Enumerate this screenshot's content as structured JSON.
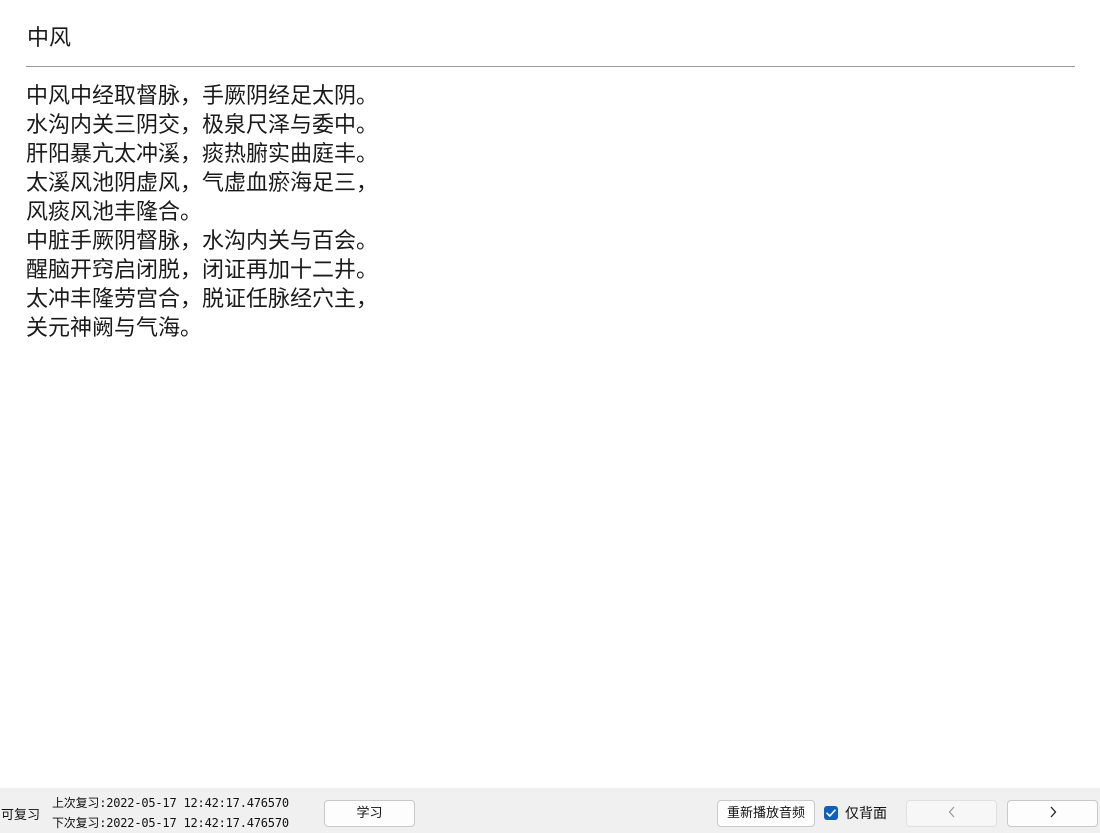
{
  "card": {
    "title": "中风",
    "lines": [
      "中风中经取督脉，手厥阴经足太阴。",
      "水沟内关三阴交，极泉尺泽与委中。",
      "肝阳暴亢太冲溪，痰热腑实曲庭丰。",
      "太溪风池阴虚风，气虚血瘀海足三，",
      "风痰风池丰隆合。",
      "中脏手厥阴督脉，水沟内关与百会。",
      "醒脑开窍启闭脱，闭证再加十二井。",
      "太冲丰隆劳宫合，脱证任脉经穴主，",
      "关元神阙与气海。"
    ]
  },
  "bottombar": {
    "due_label": "可复习",
    "last_review": "上次复习:2022-05-17 12:42:17.476570",
    "next_review": "下次复习:2022-05-17 12:42:17.476570",
    "study_button": "学习",
    "replay_audio_button": "重新播放音频",
    "back_only_checkbox": {
      "label": "仅背面",
      "checked": true
    },
    "prev_icon": "chevron-left-icon",
    "next_icon": "chevron-right-icon"
  },
  "colors": {
    "accent": "#0f5fbd",
    "bar_background": "#f0f0f0",
    "divider": "#9a9a9a"
  }
}
